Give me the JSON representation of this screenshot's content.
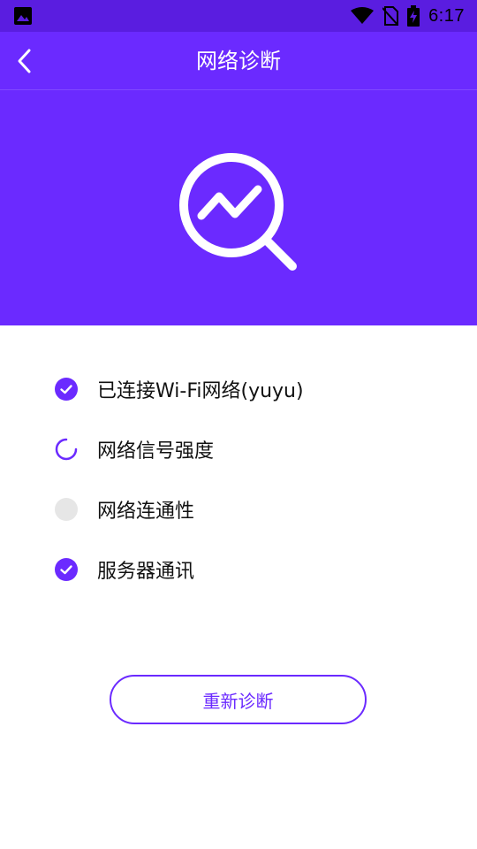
{
  "status_bar": {
    "time": "6:17",
    "icons": [
      "gallery-icon",
      "wifi-icon",
      "no-sim-icon",
      "battery-charging-icon"
    ]
  },
  "app_bar": {
    "title": "网络诊断",
    "back_icon": "chevron-left-icon"
  },
  "hero": {
    "icon": "search-trend-icon"
  },
  "checklist": [
    {
      "label": "已连接Wi-Fi网络(yuyu)",
      "state": "done"
    },
    {
      "label": "网络信号强度",
      "state": "loading"
    },
    {
      "label": "网络连通性",
      "state": "pending"
    },
    {
      "label": "服务器通讯",
      "state": "done"
    }
  ],
  "actions": {
    "rediagnose_label": "重新诊断"
  },
  "colors": {
    "primary": "#6b2aff",
    "status_bar": "#5a1de0",
    "pending": "#e6e6e6"
  }
}
